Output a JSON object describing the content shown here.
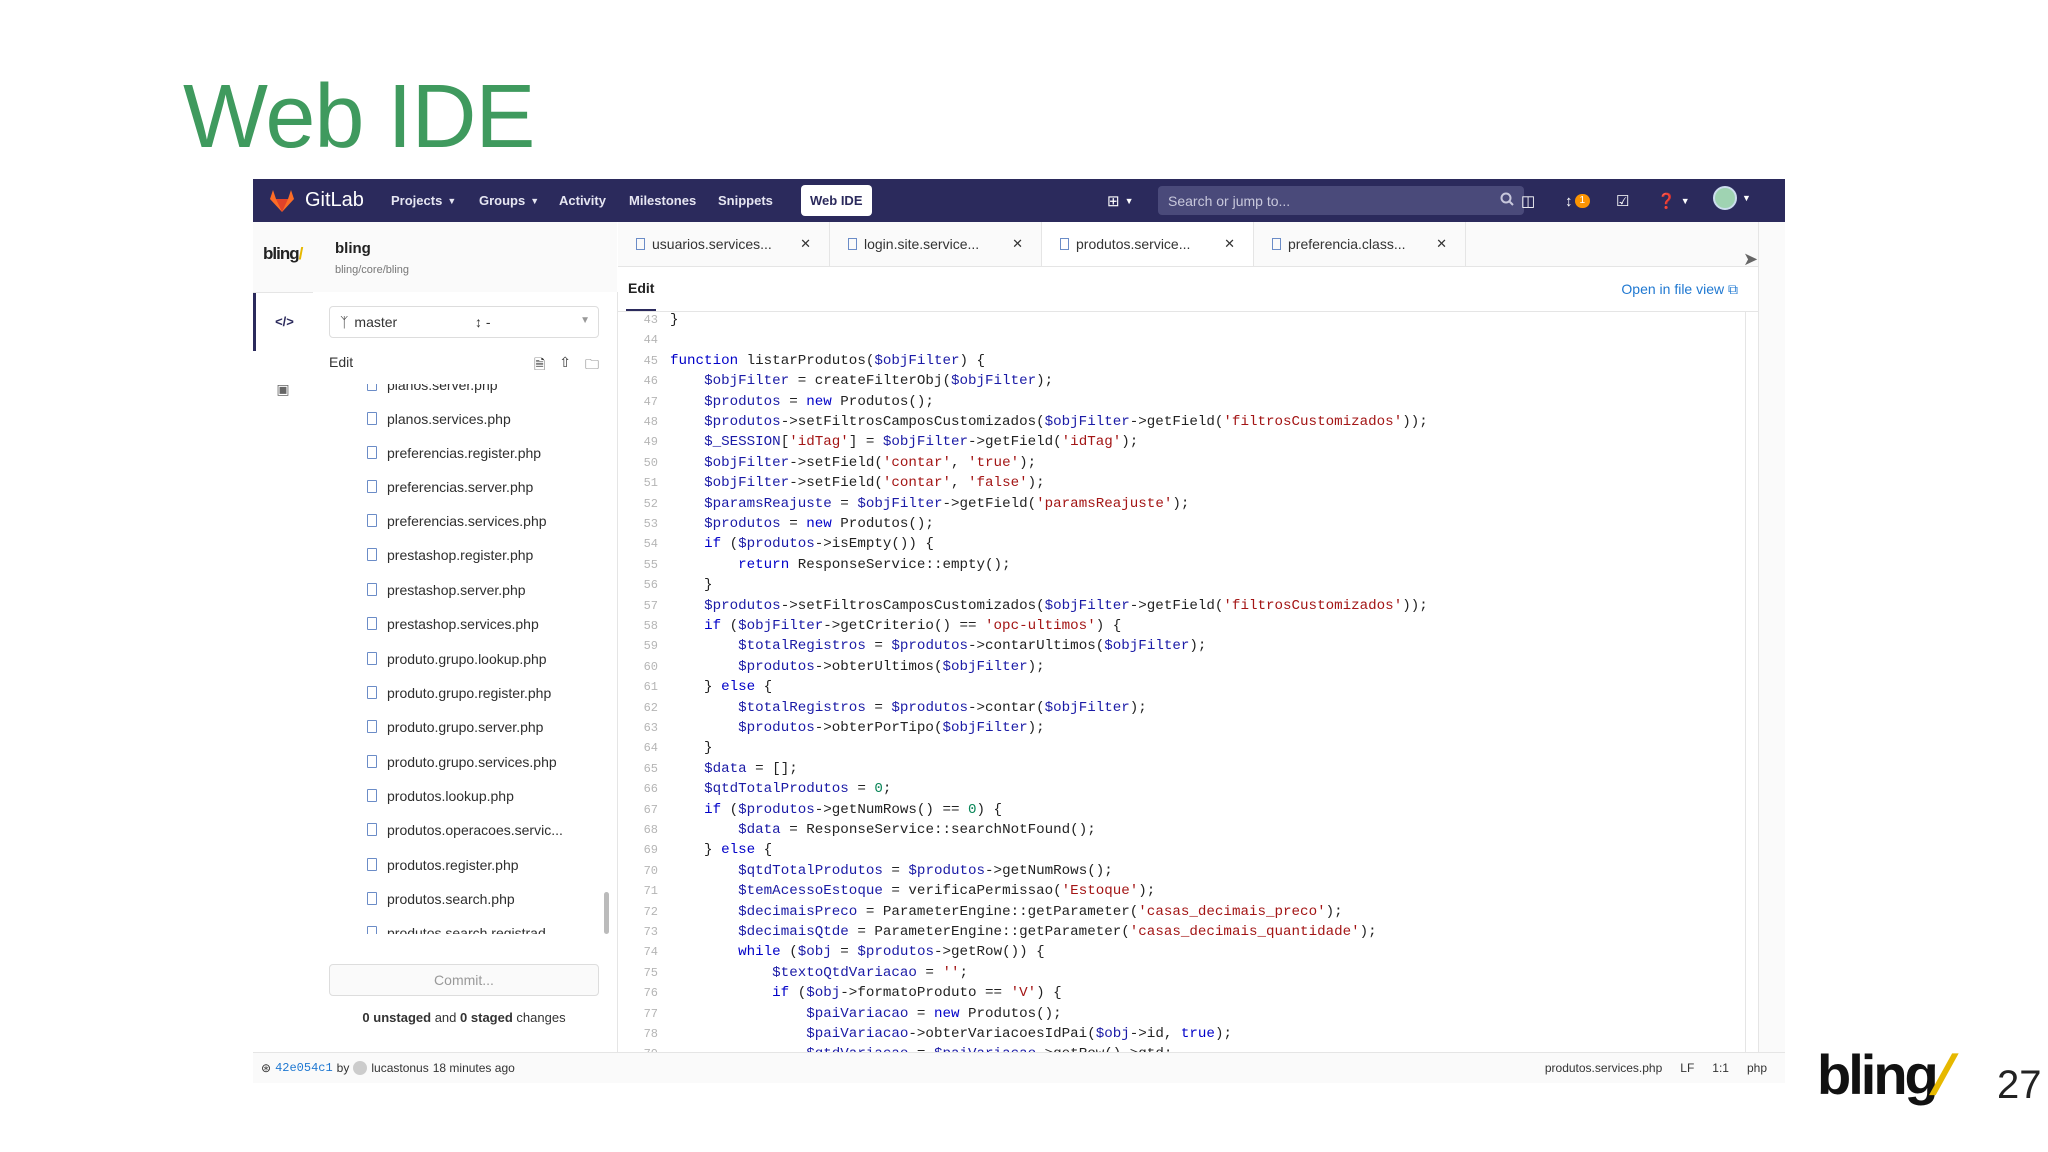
{
  "slide": {
    "title": "Web IDE",
    "page_number": "27",
    "brand": "bling"
  },
  "navbar": {
    "brand": "GitLab",
    "links": [
      "Projects",
      "Groups",
      "Activity",
      "Milestones",
      "Snippets"
    ],
    "web_ide": "Web IDE",
    "search_placeholder": "Search or jump to...",
    "mr_badge": "1"
  },
  "project": {
    "logo": "bling",
    "name": "bling",
    "path": "bling/core/bling"
  },
  "sidebar": {
    "branch": "master",
    "mr": "-",
    "edit_label": "Edit",
    "files": [
      "planos.server.php",
      "planos.services.php",
      "preferencias.register.php",
      "preferencias.server.php",
      "preferencias.services.php",
      "prestashop.register.php",
      "prestashop.server.php",
      "prestashop.services.php",
      "produto.grupo.lookup.php",
      "produto.grupo.register.php",
      "produto.grupo.server.php",
      "produto.grupo.services.php",
      "produtos.lookup.php",
      "produtos.operacoes.servic...",
      "produtos.register.php",
      "produtos.search.php",
      "produtos.search.registrad..."
    ],
    "commit_button": "Commit...",
    "changes": {
      "unstaged_count": "0",
      "unstaged_label": "unstaged",
      "and": "and",
      "staged_count": "0",
      "staged_label": "staged",
      "suffix": "changes"
    }
  },
  "tabs": [
    "usuarios.services...",
    "login.site.service...",
    "produtos.service...",
    "preferencia.class..."
  ],
  "editor": {
    "mode": "Edit",
    "open_in_file_view": "Open in file view"
  },
  "code": {
    "lines": [
      {
        "n": "43",
        "t": "}"
      },
      {
        "n": "44",
        "t": ""
      },
      {
        "n": "45",
        "t": "function listarProdutos($objFilter) {"
      },
      {
        "n": "46",
        "t": "    $objFilter = createFilterObj($objFilter);"
      },
      {
        "n": "47",
        "t": "    $produtos = new Produtos();"
      },
      {
        "n": "48",
        "t": "    $produtos->setFiltrosCamposCustomizados($objFilter->getField('filtrosCustomizados'));"
      },
      {
        "n": "49",
        "t": "    $_SESSION['idTag'] = $objFilter->getField('idTag');"
      },
      {
        "n": "50",
        "t": "    $objFilter->setField('contar', 'true');"
      },
      {
        "n": "51",
        "t": "    $objFilter->setField('contar', 'false');"
      },
      {
        "n": "52",
        "t": "    $paramsReajuste = $objFilter->getField('paramsReajuste');"
      },
      {
        "n": "53",
        "t": "    $produtos = new Produtos();"
      },
      {
        "n": "54",
        "t": "    if ($produtos->isEmpty()) {"
      },
      {
        "n": "55",
        "t": "        return ResponseService::empty();"
      },
      {
        "n": "56",
        "t": "    }"
      },
      {
        "n": "57",
        "t": "    $produtos->setFiltrosCamposCustomizados($objFilter->getField('filtrosCustomizados'));"
      },
      {
        "n": "58",
        "t": "    if ($objFilter->getCriterio() == 'opc-ultimos') {"
      },
      {
        "n": "59",
        "t": "        $totalRegistros = $produtos->contarUltimos($objFilter);"
      },
      {
        "n": "60",
        "t": "        $produtos->obterUltimos($objFilter);"
      },
      {
        "n": "61",
        "t": "    } else {"
      },
      {
        "n": "62",
        "t": "        $totalRegistros = $produtos->contar($objFilter);"
      },
      {
        "n": "63",
        "t": "        $produtos->obterPorTipo($objFilter);"
      },
      {
        "n": "64",
        "t": "    }"
      },
      {
        "n": "65",
        "t": "    $data = [];"
      },
      {
        "n": "66",
        "t": "    $qtdTotalProdutos = 0;"
      },
      {
        "n": "67",
        "t": "    if ($produtos->getNumRows() == 0) {"
      },
      {
        "n": "68",
        "t": "        $data = ResponseService::searchNotFound();"
      },
      {
        "n": "69",
        "t": "    } else {"
      },
      {
        "n": "70",
        "t": "        $qtdTotalProdutos = $produtos->getNumRows();"
      },
      {
        "n": "71",
        "t": "        $temAcessoEstoque = verificaPermissao('Estoque');"
      },
      {
        "n": "72",
        "t": "        $decimaisPreco = ParameterEngine::getParameter('casas_decimais_preco');"
      },
      {
        "n": "73",
        "t": "        $decimaisQtde = ParameterEngine::getParameter('casas_decimais_quantidade');"
      },
      {
        "n": "74",
        "t": "        while ($obj = $produtos->getRow()) {"
      },
      {
        "n": "75",
        "t": "            $textoQtdVariacao = '';"
      },
      {
        "n": "76",
        "t": "            if ($obj->formatoProduto == 'V') {"
      },
      {
        "n": "77",
        "t": "                $paiVariacao = new Produtos();"
      },
      {
        "n": "78",
        "t": "                $paiVariacao->obterVariacoesIdPai($obj->id, true);"
      },
      {
        "n": "79",
        "t": "                $qtdVariacao = $paiVariacao->getRow()->qtd;"
      }
    ]
  },
  "status": {
    "commit_hash": "42e054c1",
    "by": "by",
    "author": "lucastonus",
    "time": "18 minutes ago",
    "filename": "produtos.services.php",
    "eol": "LF",
    "position": "1:1",
    "language": "php"
  }
}
